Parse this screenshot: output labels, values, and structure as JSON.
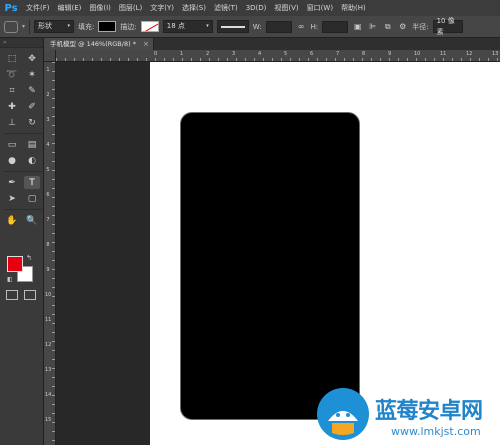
{
  "app": {
    "logo": "Ps",
    "brand_color": "#31a8ff"
  },
  "menubar": {
    "items": [
      {
        "label": "文件(F)",
        "name": "menu-file"
      },
      {
        "label": "编辑(E)",
        "name": "menu-edit"
      },
      {
        "label": "图像(I)",
        "name": "menu-image"
      },
      {
        "label": "图层(L)",
        "name": "menu-layer"
      },
      {
        "label": "文字(Y)",
        "name": "menu-type"
      },
      {
        "label": "选择(S)",
        "name": "menu-select"
      },
      {
        "label": "滤镜(T)",
        "name": "menu-filter"
      },
      {
        "label": "3D(D)",
        "name": "menu-3d"
      },
      {
        "label": "视图(V)",
        "name": "menu-view"
      },
      {
        "label": "窗口(W)",
        "name": "menu-window"
      },
      {
        "label": "帮助(H)",
        "name": "menu-help"
      }
    ]
  },
  "options": {
    "mode_value": "形状",
    "fill_label": "填充:",
    "fill_color": "#000000",
    "stroke_label": "描边:",
    "stroke_width_value": "18 点",
    "width_label": "W:",
    "height_label": "H:",
    "radius_label": "半径:",
    "radius_value": "10 像素"
  },
  "document": {
    "tab_label": "手机模型 @ 146%(RGB/8) *",
    "close_glyph": "×"
  },
  "rulers": {
    "horizontal": [
      "0",
      "1",
      "2",
      "3",
      "4",
      "5",
      "6",
      "7",
      "8",
      "9",
      "10",
      "11",
      "12",
      "13"
    ],
    "vertical": [
      "1",
      "2",
      "3",
      "4",
      "5",
      "6",
      "7",
      "8",
      "9",
      "10",
      "11",
      "12",
      "13",
      "14",
      "15"
    ]
  },
  "colors": {
    "foreground": "#e60012",
    "background": "#ffffff"
  },
  "tools": [
    {
      "name": "marquee-tool-icon",
      "glyph": "⬚"
    },
    {
      "name": "move-tool-icon",
      "glyph": "✥"
    },
    {
      "name": "lasso-tool-icon",
      "glyph": "➰"
    },
    {
      "name": "magic-wand-tool-icon",
      "glyph": "✶"
    },
    {
      "name": "crop-tool-icon",
      "glyph": "⌗"
    },
    {
      "name": "eyedropper-tool-icon",
      "glyph": "✎"
    },
    {
      "name": "healing-brush-tool-icon",
      "glyph": "✚"
    },
    {
      "name": "brush-tool-icon",
      "glyph": "✐"
    },
    {
      "name": "clone-stamp-tool-icon",
      "glyph": "⊥"
    },
    {
      "name": "history-brush-tool-icon",
      "glyph": "↻"
    },
    {
      "name": "eraser-tool-icon",
      "glyph": "▭"
    },
    {
      "name": "gradient-tool-icon",
      "glyph": "▤"
    },
    {
      "name": "blur-tool-icon",
      "glyph": "●"
    },
    {
      "name": "dodge-tool-icon",
      "glyph": "◐"
    },
    {
      "name": "pen-tool-icon",
      "glyph": "✒"
    },
    {
      "name": "type-tool-icon",
      "glyph": "T"
    },
    {
      "name": "path-selection-tool-icon",
      "glyph": "➤"
    },
    {
      "name": "shape-tool-icon",
      "glyph": "▢"
    },
    {
      "name": "hand-tool-icon",
      "glyph": "✋"
    },
    {
      "name": "zoom-tool-icon",
      "glyph": "🔍"
    }
  ],
  "watermark": {
    "title": "蓝莓安卓网",
    "url": "www.lmkjst.com"
  }
}
